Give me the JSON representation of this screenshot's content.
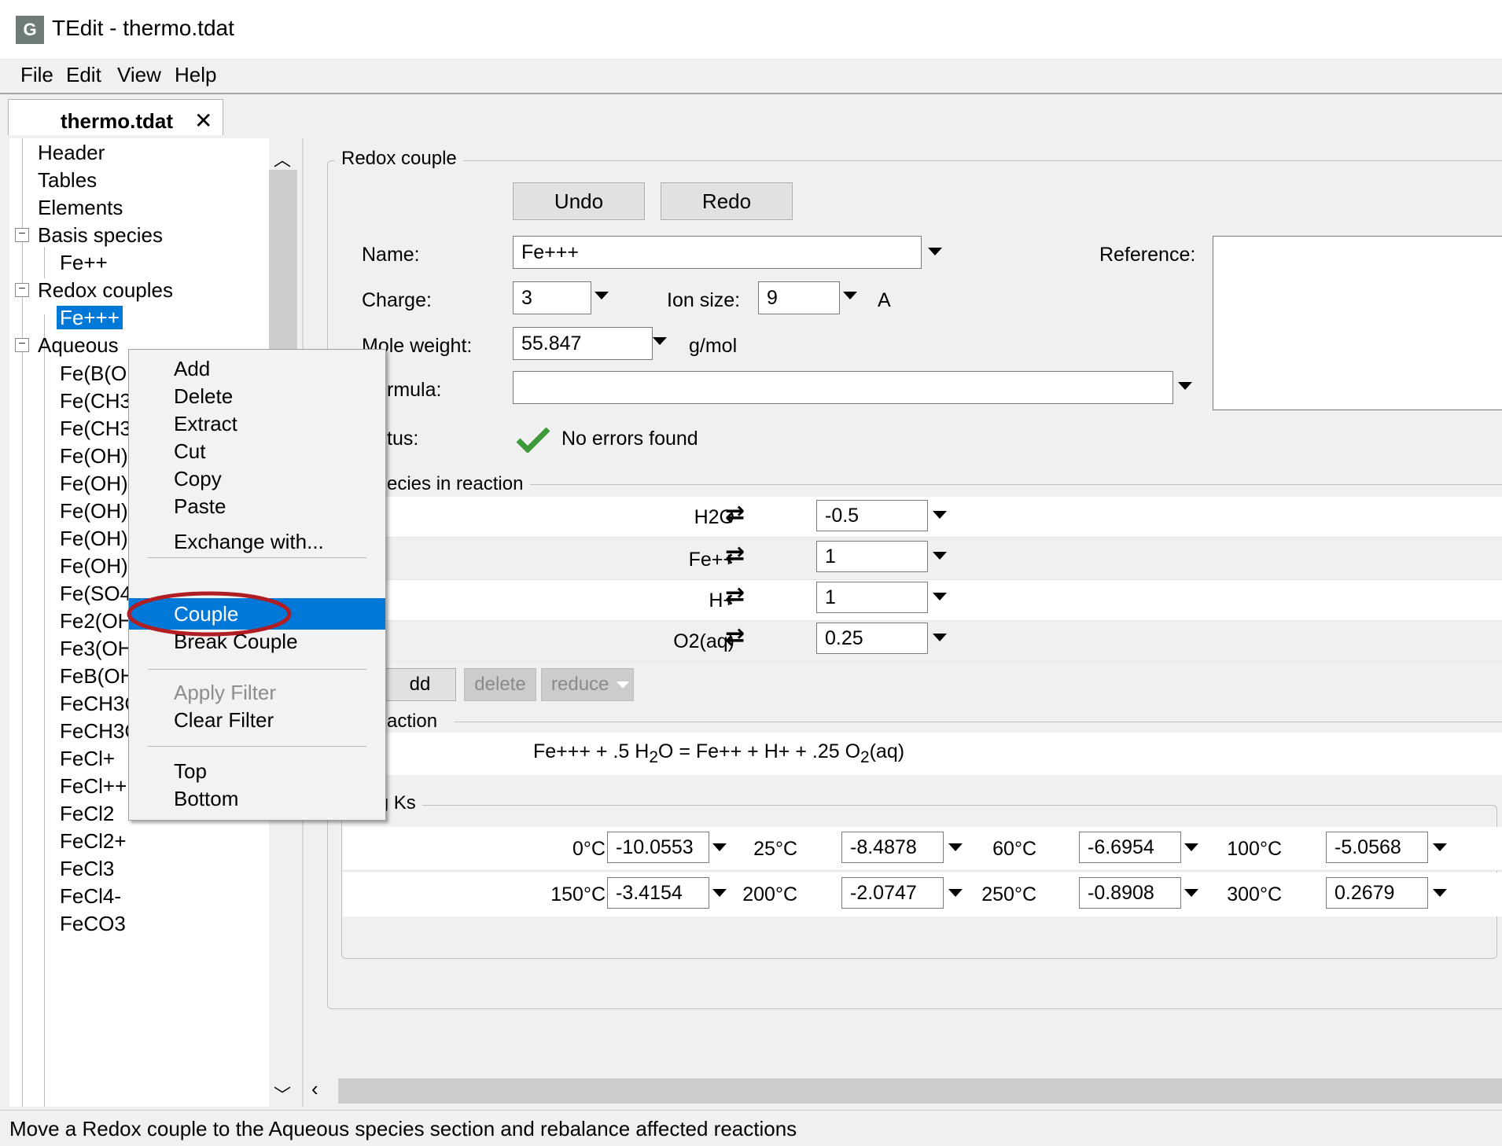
{
  "window": {
    "title": "TEdit - thermo.tdat",
    "icon_text": "G"
  },
  "menubar": [
    "File",
    "Edit",
    "View",
    "Help"
  ],
  "tab": {
    "label": "thermo.tdat",
    "close_glyph": "✕"
  },
  "tree": {
    "top_items": [
      "Header",
      "Tables",
      "Elements"
    ],
    "basis_label": "Basis species",
    "basis_children": [
      "Fe++"
    ],
    "redox_label": "Redox couples",
    "redox_children": [
      "Fe+++"
    ],
    "aqueous_label": "Aqueous",
    "aqueous_children": [
      "Fe(B(OH",
      "Fe(CH3",
      "Fe(CH3",
      "Fe(OH)",
      "Fe(OH)",
      "Fe(OH)",
      "Fe(OH)",
      "Fe(OH)",
      "Fe(SO4",
      "Fe2(OH",
      "Fe3(OH",
      "FeB(OH",
      "FeCH3COO+",
      "FeCH3COO++",
      "FeCl+",
      "FeCl++",
      "FeCl2",
      "FeCl2+",
      "FeCl3",
      "FeCl4-",
      "FeCO3"
    ]
  },
  "context_menu": {
    "items": [
      "Add",
      "Delete",
      "Extract",
      "Cut",
      "Copy",
      "Paste",
      "Exchange with...",
      "Couple",
      "Break Couple",
      "Apply Filter",
      "Clear Filter",
      "Top",
      "Bottom"
    ],
    "highlighted": "Couple",
    "disabled": [
      "Apply Filter"
    ]
  },
  "redox": {
    "group_title": "Redox couple",
    "undo": "Undo",
    "redo": "Redo",
    "name_label": "Name:",
    "name_value": "Fe+++",
    "reference_label": "Reference:",
    "charge_label": "Charge:",
    "charge_value": "3",
    "ion_size_label": "Ion size:",
    "ion_size_value": "9",
    "ion_size_unit": "A",
    "mole_weight_label": "Mole weight:",
    "mole_weight_value": "55.847",
    "mole_weight_unit": "g/mol",
    "formula_label": "rmula:",
    "formula_value": "",
    "status_label": "tus:",
    "status_text": "No errors found",
    "species_title": "ecies in reaction",
    "species": [
      {
        "name": "H2O",
        "coef": "-0.5"
      },
      {
        "name": "Fe++",
        "coef": "1"
      },
      {
        "name": "H+",
        "coef": "1"
      },
      {
        "name": "O2(aq)",
        "coef": "0.25"
      }
    ],
    "add_btn": "dd",
    "delete_btn": "delete",
    "reduce_btn": "reduce",
    "reaction_title": "action",
    "reaction": {
      "lhs": "Fe+++  +  .5 H",
      "lhs_sub": "2",
      "lhs_end": "O  =  Fe++  +  H+  +  .25 O",
      "rhs_sub": "2",
      "rhs_end": "(aq)"
    },
    "logk_title": "Log Ks",
    "logk": [
      {
        "t": "0°C",
        "v": "-10.0553"
      },
      {
        "t": "25°C",
        "v": "-8.4878"
      },
      {
        "t": "60°C",
        "v": "-6.6954"
      },
      {
        "t": "100°C",
        "v": "-5.0568"
      },
      {
        "t": "150°C",
        "v": "-3.4154"
      },
      {
        "t": "200°C",
        "v": "-2.0747"
      },
      {
        "t": "250°C",
        "v": "-0.8908"
      },
      {
        "t": "300°C",
        "v": "0.2679"
      }
    ]
  },
  "statusbar": "Move a Redox couple to the Aqueous species section and rebalance affected reactions",
  "colors": {
    "selection": "#0078d7",
    "highlight_ring": "#b01e23",
    "check": "#3c9a3c"
  }
}
